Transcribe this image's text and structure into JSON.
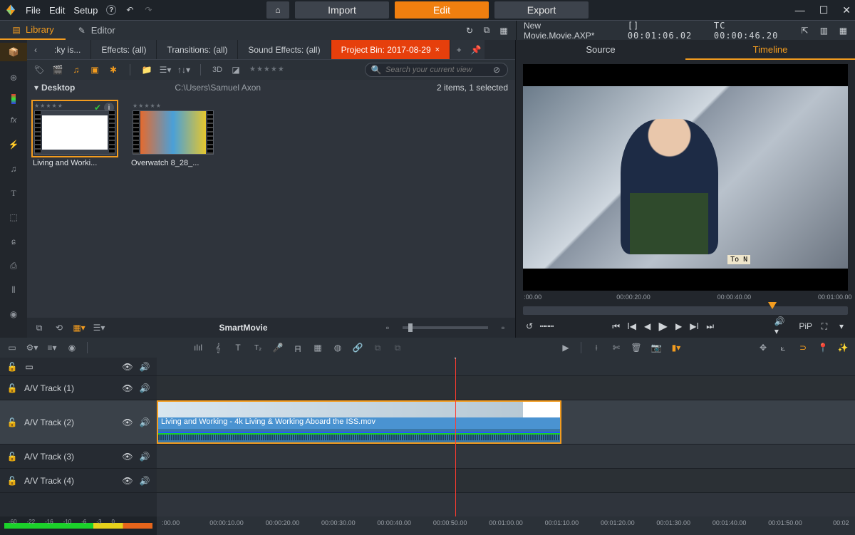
{
  "menubar": {
    "items": [
      "File",
      "Edit",
      "Setup"
    ]
  },
  "modes": {
    "home": "⌂",
    "import": "Import",
    "edit": "Edit",
    "export": "Export"
  },
  "subheader": {
    "library": "Library",
    "editor": "Editor",
    "project_name": "New Movie.Movie.AXP*",
    "tc_bracket": "[] 00:01:06.02",
    "tc_label": "TC  00:00:46.20"
  },
  "panel_tabs": [
    {
      "label": ":ky is..."
    },
    {
      "label": "Effects: (all)"
    },
    {
      "label": "Transitions: (all)"
    },
    {
      "label": "Sound Effects: (all)"
    },
    {
      "label": "Project Bin: 2017-08-29",
      "active": true,
      "closeable": true
    }
  ],
  "search": {
    "placeholder": "Search your current view"
  },
  "path": {
    "folder": "Desktop",
    "root": "C:\\Users\\Samuel Axon",
    "count": "2 items, 1 selected"
  },
  "clips": [
    {
      "name": "Living and Worki...",
      "selected": true,
      "checked": true
    },
    {
      "name": "Overwatch 8_28_..."
    }
  ],
  "smart": "SmartMovie",
  "preview_tabs": {
    "source": "Source",
    "timeline": "Timeline"
  },
  "preview_ruler": [
    ":00.00",
    "00:00:20.00",
    "00:00:40.00",
    "00:01:00.00"
  ],
  "to_nc": "To  N",
  "pip": "PiP",
  "tracks": [
    {
      "name": ""
    },
    {
      "name": "A/V Track (1)"
    },
    {
      "name": "A/V Track (2)",
      "big": true,
      "clip": {
        "title": "Living and Working - 4k Living & Working Aboard the ISS.mov"
      }
    },
    {
      "name": "A/V Track (3)"
    },
    {
      "name": "A/V Track (4)"
    }
  ],
  "meter_labels": [
    "-60",
    "-22",
    "-16",
    "-10",
    "-6",
    "-3",
    "0"
  ],
  "bottom_ruler": [
    ":00.00",
    "00:00:10.00",
    "00:00:20.00",
    "00:00:30.00",
    "00:00:40.00",
    "00:00:50.00",
    "00:01:00.00",
    "00:01:10.00",
    "00:01:20.00",
    "00:01:30.00",
    "00:01:40.00",
    "00:01:50.00",
    "00:02"
  ],
  "side_rail": [
    "box",
    "globe",
    "palette",
    "fx",
    "bolt",
    "music",
    "text",
    "shapes",
    "tuning",
    "titles",
    "audio-wave",
    "disc"
  ]
}
